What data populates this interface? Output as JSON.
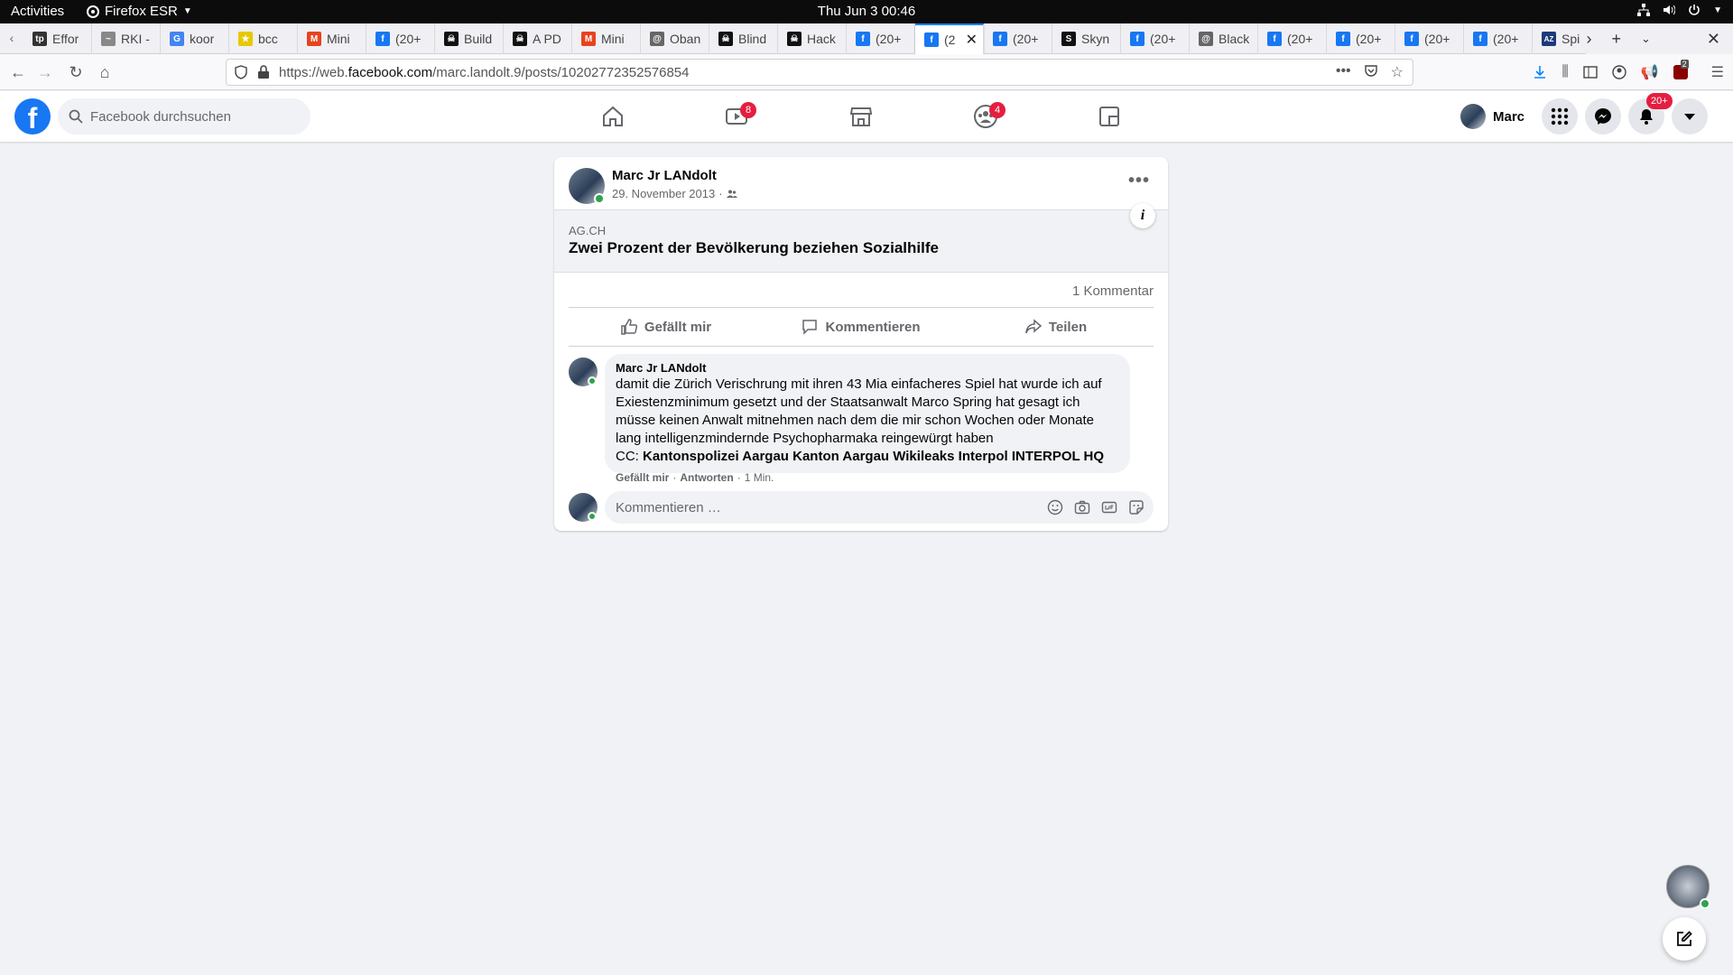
{
  "system_bar": {
    "activities": "Activities",
    "app_name": "Firefox ESR",
    "clock": "Thu Jun 3  00:46"
  },
  "browser": {
    "tabs": [
      {
        "label": "Effor",
        "icon": "tp-icon",
        "color": "#333333"
      },
      {
        "label": "RKI -",
        "icon": "rki-icon",
        "color": "#888888"
      },
      {
        "label": "koor",
        "icon": "google-icon",
        "color": "#4285f4"
      },
      {
        "label": "bcc",
        "icon": "bcc-icon",
        "color": "#e6c800"
      },
      {
        "label": "Mini",
        "icon": "mini-icon",
        "color": "#e8431d"
      },
      {
        "label": "(20+",
        "icon": "facebook-icon",
        "color": "#1877f2"
      },
      {
        "label": "Build",
        "icon": "hackaday-icon",
        "color": "#111111"
      },
      {
        "label": "A PD",
        "icon": "hackaday-icon",
        "color": "#111111"
      },
      {
        "label": "Mini",
        "icon": "mini-icon",
        "color": "#e8431d"
      },
      {
        "label": "Oban",
        "icon": "at-icon",
        "color": "#666666"
      },
      {
        "label": "Blind",
        "icon": "hackaday-icon",
        "color": "#111111"
      },
      {
        "label": "Hack",
        "icon": "hackaday-icon",
        "color": "#111111"
      },
      {
        "label": "(20+",
        "icon": "facebook-icon",
        "color": "#1877f2"
      },
      {
        "label": "(2",
        "icon": "facebook-icon",
        "color": "#1877f2",
        "active": true
      },
      {
        "label": "(20+",
        "icon": "facebook-icon",
        "color": "#1877f2"
      },
      {
        "label": "Skyn",
        "icon": "skynet-icon",
        "color": "#111111"
      },
      {
        "label": "(20+",
        "icon": "facebook-icon",
        "color": "#1877f2"
      },
      {
        "label": "Black",
        "icon": "at-icon",
        "color": "#666666"
      },
      {
        "label": "(20+",
        "icon": "facebook-icon",
        "color": "#1877f2"
      },
      {
        "label": "(20+",
        "icon": "facebook-icon",
        "color": "#1877f2"
      },
      {
        "label": "(20+",
        "icon": "facebook-icon",
        "color": "#1877f2"
      },
      {
        "label": "(20+",
        "icon": "facebook-icon",
        "color": "#1877f2"
      },
      {
        "label": "Spi",
        "icon": "az-icon",
        "color": "#1d3a7a"
      }
    ],
    "url_prefix": "https://web.",
    "url_domain": "facebook.com",
    "url_path": "/marc.landolt.9/posts/10202772352576854",
    "addon_badge": "2"
  },
  "fb": {
    "search_placeholder": "Facebook durchsuchen",
    "watch_badge": "8",
    "groups_badge": "4",
    "profile_name": "Marc",
    "notifications_badge": "20+",
    "brand_color": "#1877f2"
  },
  "post": {
    "author": "Marc Jr LANdolt",
    "date": "29. November 2013",
    "link_domain": "AG.CH",
    "link_title": "Zwei Prozent der Bevölkerung beziehen Sozialhilfe",
    "comment_count": "1 Kommentar",
    "actions": {
      "like": "Gefällt mir",
      "comment": "Kommentieren",
      "share": "Teilen"
    },
    "comment": {
      "author": "Marc Jr LANdolt",
      "text": "damit die Zürich Verischrung mit ihren 43 Mia einfacheres Spiel hat wurde ich auf\nExiestenzminimum gesetzt und der Staatsanwalt Marco Spring hat gesagt ich\nmüsse keinen Anwalt mitnehmen nach dem die mir schon Wochen oder Monate\nlang intelligenzmindernde Psychopharmaka reingewürgt haben",
      "cc_prefix": "CC: ",
      "cc_tags": "Kantonspolizei Aargau Kanton Aargau Wikileaks Interpol INTERPOL HQ",
      "like": "Gefällt mir",
      "reply": "Antworten",
      "time": "1 Min."
    },
    "new_comment_placeholder": "Kommentieren …"
  }
}
